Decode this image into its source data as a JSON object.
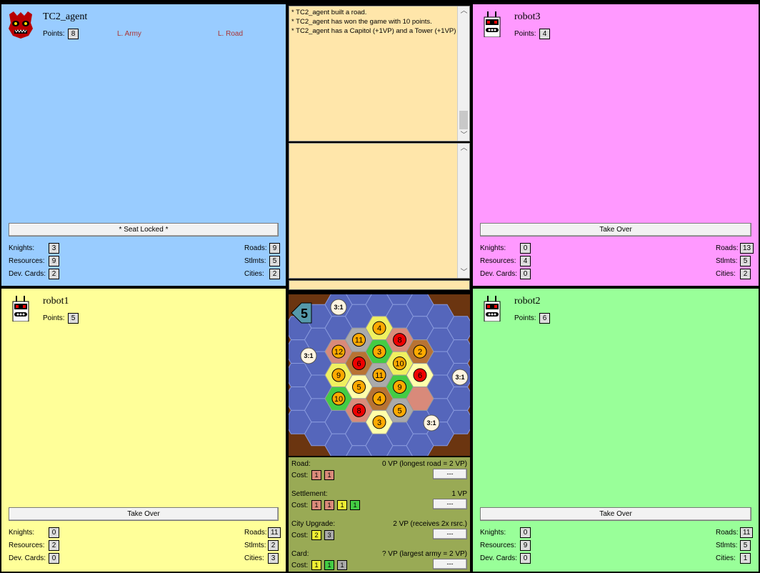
{
  "colors": {
    "blue": "#99ccff",
    "pink": "#ff99ff",
    "yellow": "#ffff99",
    "green": "#99ff99",
    "chat": "#ffe6aa",
    "build": "#99aa55",
    "board_bg": "#6b3510"
  },
  "players": {
    "tc2": {
      "name": "TC2_agent",
      "points_label": "Points:",
      "points": "8",
      "largest_army": "L. Army",
      "longest_road": "L. Road",
      "button": "* Seat Locked *",
      "knights_label": "Knights:",
      "knights": "3",
      "resources_label": "Resources:",
      "resources": "9",
      "devcards_label": "Dev. Cards:",
      "devcards": "2",
      "roads_label": "Roads:",
      "roads": "9",
      "stlmts_label": "Stlmts:",
      "stlmts": "5",
      "cities_label": "Cities:",
      "cities": "2",
      "avatar": "demon-face-icon"
    },
    "robot3": {
      "name": "robot3",
      "points_label": "Points:",
      "points": "4",
      "button": "Take Over",
      "knights_label": "Knights:",
      "knights": "0",
      "resources_label": "Resources:",
      "resources": "4",
      "devcards_label": "Dev. Cards:",
      "devcards": "0",
      "roads_label": "Roads:",
      "roads": "13",
      "stlmts_label": "Stlmts:",
      "stlmts": "5",
      "cities_label": "Cities:",
      "cities": "2",
      "avatar": "robot-icon"
    },
    "robot1": {
      "name": "robot1",
      "points_label": "Points:",
      "points": "5",
      "button": "Take Over",
      "knights_label": "Knights:",
      "knights": "0",
      "resources_label": "Resources:",
      "resources": "2",
      "devcards_label": "Dev. Cards:",
      "devcards": "0",
      "roads_label": "Roads:",
      "roads": "11",
      "stlmts_label": "Stlmts:",
      "stlmts": "2",
      "cities_label": "Cities:",
      "cities": "3",
      "avatar": "robot-icon"
    },
    "robot2": {
      "name": "robot2",
      "points_label": "Points:",
      "points": "6",
      "button": "Take Over",
      "knights_label": "Knights:",
      "knights": "0",
      "resources_label": "Resources:",
      "resources": "9",
      "devcards_label": "Dev. Cards:",
      "devcards": "0",
      "roads_label": "Roads:",
      "roads": "11",
      "stlmts_label": "Stlmts:",
      "stlmts": "5",
      "cities_label": "Cities:",
      "cities": "1",
      "avatar": "robot-icon"
    }
  },
  "chat": {
    "lines": [
      "* TC2_agent built a road.",
      "* TC2_agent has won the game with 10 points.",
      "* TC2_agent has a Capitol (+1VP) and a Tower (+1VP)"
    ],
    "input_value": ""
  },
  "board": {
    "dice": "5",
    "ports": [
      "3:1",
      "3:1",
      "3:1",
      "3:1"
    ],
    "numbers": [
      "12",
      "9",
      "10",
      "11",
      "6",
      "5",
      "8",
      "4",
      "3",
      "11",
      "4",
      "3",
      "8",
      "10",
      "9",
      "5",
      "2",
      "6"
    ]
  },
  "build": {
    "road": {
      "label": "Road:",
      "vp": "0 VP  (longest road = 2 VP)",
      "cost_label": "Cost:",
      "costs": [
        "1",
        "1"
      ],
      "button": "---"
    },
    "settlement": {
      "label": "Settlement:",
      "vp": "1 VP",
      "cost_label": "Cost:",
      "costs": [
        "1",
        "1",
        "1",
        "1"
      ],
      "button": "---"
    },
    "city": {
      "label": "City Upgrade:",
      "vp": "2 VP  (receives 2x rsrc.)",
      "cost_label": "Cost:",
      "costs": [
        "2",
        "3"
      ],
      "button": "---"
    },
    "card": {
      "label": "Card:",
      "vp": "? VP  (largest army = 2 VP)",
      "cost_label": "Cost:",
      "costs": [
        "1",
        "1",
        "1"
      ],
      "button": "---"
    }
  }
}
